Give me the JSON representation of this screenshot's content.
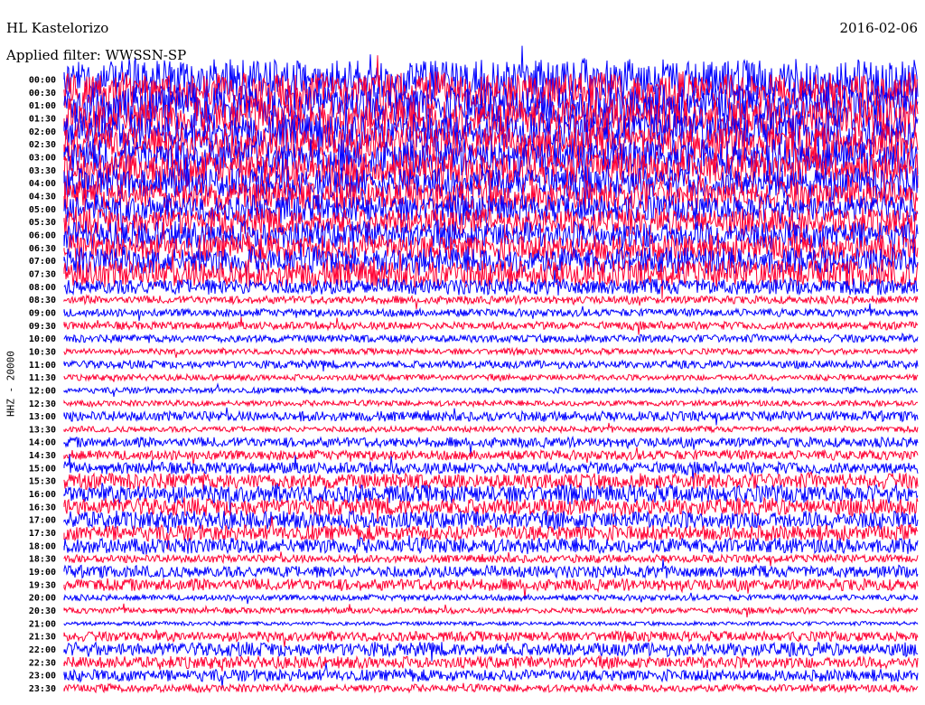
{
  "header": {
    "station": "HL Kastelorizo",
    "date": "2016-02-06",
    "filter": "Applied filter: WWSSN-SP"
  },
  "chart_data": {
    "type": "line",
    "title": "HL Kastelorizo",
    "ylabel": "HHZ - 20000",
    "colors": [
      "#0000ff",
      "#ff0033"
    ],
    "row_labels": [
      "00:00",
      "00:30",
      "01:00",
      "01:30",
      "02:00",
      "02:30",
      "03:00",
      "03:30",
      "04:00",
      "04:30",
      "05:00",
      "05:30",
      "06:00",
      "06:30",
      "07:00",
      "07:30",
      "08:00",
      "08:30",
      "09:00",
      "09:30",
      "10:00",
      "10:30",
      "11:00",
      "11:30",
      "12:00",
      "12:30",
      "13:00",
      "13:30",
      "14:00",
      "14:30",
      "15:00",
      "15:30",
      "16:00",
      "16:30",
      "17:00",
      "17:30",
      "18:00",
      "18:30",
      "19:00",
      "19:30",
      "20:00",
      "20:30",
      "21:00",
      "21:30",
      "22:00",
      "22:30",
      "23:00",
      "23:30"
    ],
    "relative_amplitude": [
      20,
      20,
      20,
      20,
      18,
      18,
      18,
      18,
      16,
      16,
      14,
      14,
      14,
      14,
      14,
      14,
      8,
      4,
      4,
      4,
      4,
      3,
      4,
      3,
      3,
      3,
      5,
      3,
      5,
      5,
      6,
      8,
      9,
      9,
      9,
      8,
      8,
      4,
      6,
      6,
      3,
      3,
      2,
      5,
      7,
      6,
      6,
      4
    ]
  }
}
